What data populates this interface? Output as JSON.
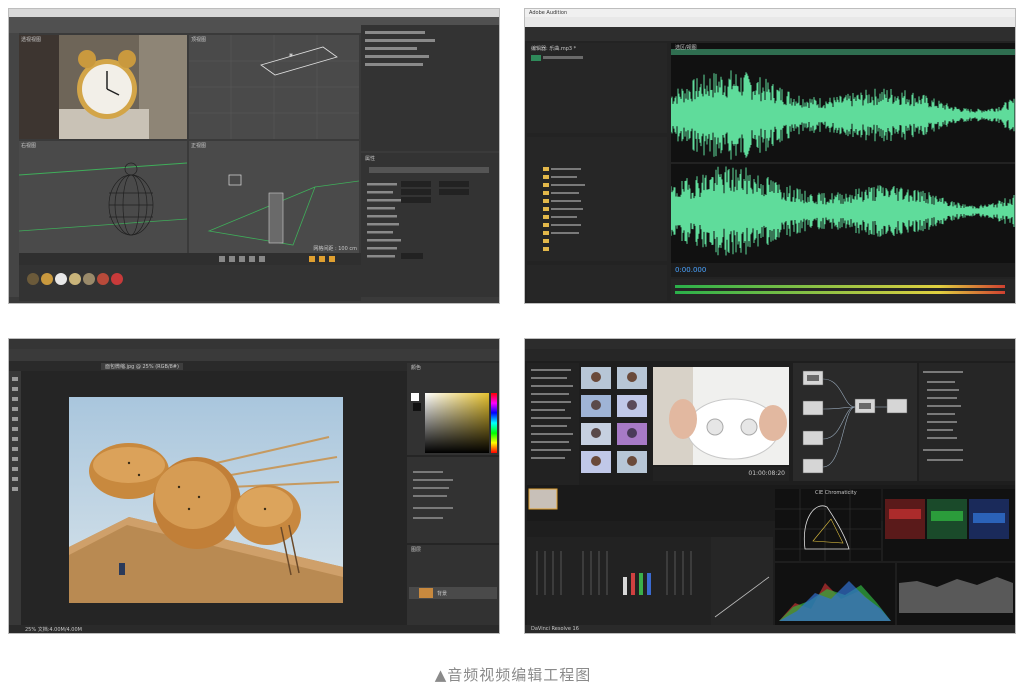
{
  "caption": "▲音频视频编辑工程图",
  "c4d": {
    "persp_label": "透视视图",
    "top_label": "顶视图",
    "right_label": "右视图",
    "front_label": "正视图",
    "panel_title": "属性",
    "grid_note": "网格间距 : 100 cm"
  },
  "audition": {
    "title": "Adobe Audition",
    "file_name": "编辑器: 乐曲.mp3 *",
    "time_readout": "0:00.000",
    "selection_label": "选区/视图"
  },
  "photoshop": {
    "tab_name": "面包微缩.jpg @ 25% (RGB/8#)",
    "layer_name": "背景",
    "panel_color": "颜色",
    "panel_layers": "图层",
    "status": "25%  文档:4.00M/4.00M"
  },
  "resolve": {
    "timecode": "01:00:08:20",
    "scope_title": "CIE Chromaticity",
    "app_name": "DaVinci Resolve 16"
  },
  "colors": {
    "dark_ui": "#2b2b2b",
    "waveform": "#5fdc9b",
    "ps_accent": "#31a8ff",
    "resolve_accent": "#e0a030"
  }
}
